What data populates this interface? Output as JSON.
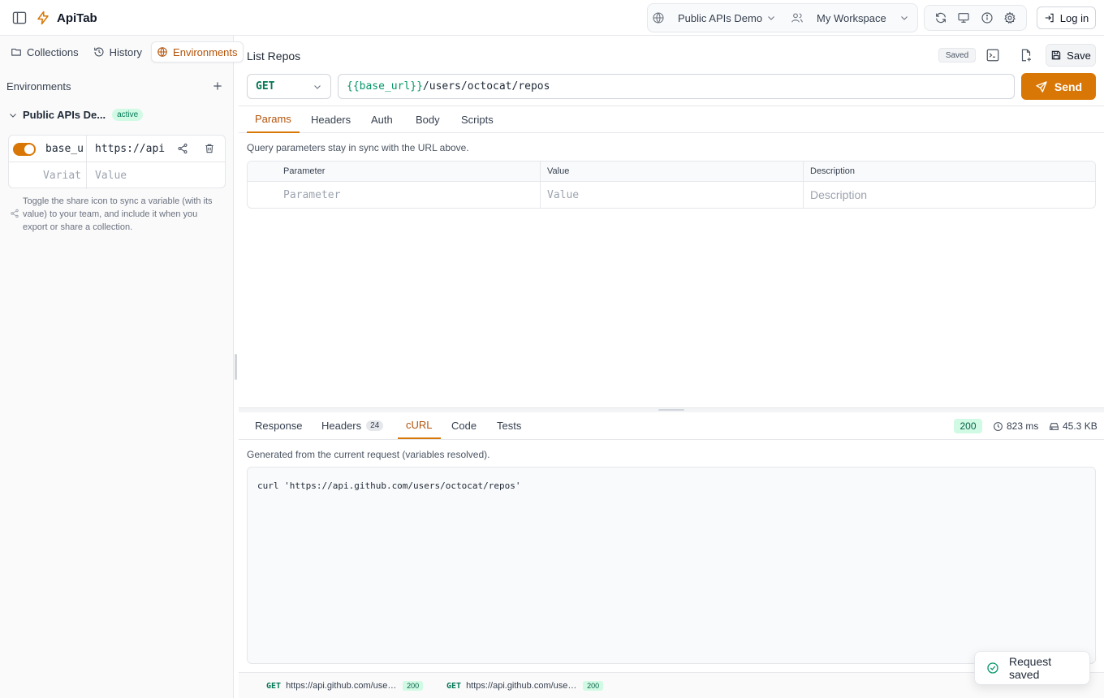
{
  "app": {
    "name": "ApiTab",
    "accent": "#d97706",
    "success": "#059669"
  },
  "header": {
    "collection_selector": "Public APIs Demo",
    "workspace_selector": "My Workspace",
    "login_label": "Log in"
  },
  "sidebar": {
    "tabs": [
      {
        "label": "Collections",
        "icon": "folder-icon"
      },
      {
        "label": "History",
        "icon": "history-icon"
      },
      {
        "label": "Environments",
        "icon": "globe-icon",
        "active": true
      }
    ],
    "section_title": "Environments",
    "environment": {
      "name": "Public APIs De...",
      "badge": "active"
    },
    "variables": [
      {
        "key": "base_u",
        "value": "https://api",
        "enabled": true
      }
    ],
    "new_variable": {
      "key_placeholder": "Variat",
      "value_placeholder": "Value"
    },
    "help_text": "Toggle the share icon to sync a variable (with its value) to your team, and include it when you export or share a collection."
  },
  "request": {
    "title": "List Repos",
    "saved_badge": "Saved",
    "save_label": "Save",
    "method": "GET",
    "url_variable": "{{base_url}}",
    "url_path": "/users/octocat/repos",
    "send_label": "Send",
    "tabs": [
      "Params",
      "Headers",
      "Auth",
      "Body",
      "Scripts"
    ],
    "active_tab": "Params",
    "params_hint": "Query parameters stay in sync with the URL above.",
    "params_columns": [
      "Parameter",
      "Value",
      "Description"
    ],
    "params_placeholders": [
      "Parameter",
      "Value",
      "Description"
    ]
  },
  "response": {
    "tabs": [
      {
        "label": "Response"
      },
      {
        "label": "Headers",
        "count": "24"
      },
      {
        "label": "cURL",
        "active": true
      },
      {
        "label": "Code"
      },
      {
        "label": "Tests"
      }
    ],
    "status": "200",
    "time": "823 ms",
    "size": "45.3 KB",
    "curl_hint": "Generated from the current request (variables resolved).",
    "curl_command": "curl 'https://api.github.com/users/octocat/repos'"
  },
  "history": [
    {
      "method": "GET",
      "url": "https://api.github.com/users/octocat/repos",
      "status": "200"
    },
    {
      "method": "GET",
      "url": "https://api.github.com/users/octocat/repos",
      "status": "200"
    }
  ],
  "toast": {
    "message": "Request saved"
  }
}
